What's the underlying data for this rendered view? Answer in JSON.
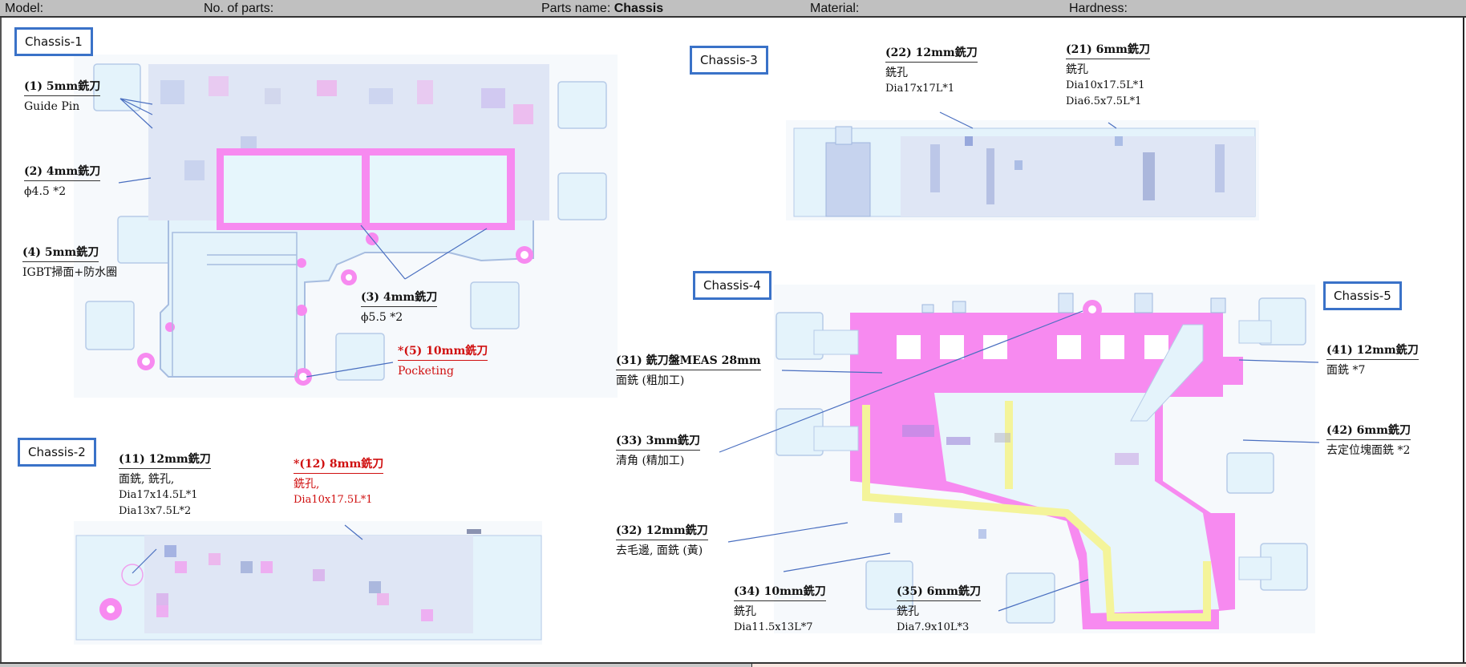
{
  "header": {
    "model_label": "Model:",
    "parts_count_label": "No. of parts:",
    "parts_name_label": "Parts name:",
    "parts_name_value": "Chassis",
    "material_label": "Material:",
    "hardness_label": "Hardness:"
  },
  "views": [
    {
      "id": "chassis-1",
      "label": "Chassis-1"
    },
    {
      "id": "chassis-2",
      "label": "Chassis-2"
    },
    {
      "id": "chassis-3",
      "label": "Chassis-3"
    },
    {
      "id": "chassis-4",
      "label": "Chassis-4"
    },
    {
      "id": "chassis-5",
      "label": "Chassis-5"
    }
  ],
  "annotations": {
    "a1": {
      "title": "(1) 5mm銑刀",
      "lines": [
        "Guide Pin"
      ]
    },
    "a2": {
      "title": "(2) 4mm銑刀",
      "lines": [
        "ϕ4.5 *2"
      ]
    },
    "a4": {
      "title": "(4) 5mm銑刀",
      "lines": [
        "IGBT掃面+防水圈"
      ]
    },
    "a3": {
      "title": "(3) 4mm銑刀",
      "lines": [
        "ϕ5.5 *2"
      ]
    },
    "a5": {
      "title": "*(5) 10mm銑刀",
      "lines": [
        "Pocketing"
      ],
      "highlight": true
    },
    "a11": {
      "title": "(11) 12mm銑刀",
      "lines": [
        "面銑, 銑孔,",
        "Dia17x14.5L*1",
        "Dia13x7.5L*2"
      ]
    },
    "a12": {
      "title": "*(12) 8mm銑刀",
      "lines": [
        "銑孔,",
        "Dia10x17.5L*1"
      ],
      "highlight": true
    },
    "a22": {
      "title": "(22) 12mm銑刀",
      "lines": [
        "銑孔",
        "Dia17x17L*1"
      ]
    },
    "a21": {
      "title": "(21) 6mm銑刀",
      "lines": [
        "銑孔",
        "Dia10x17.5L*1",
        "Dia6.5x7.5L*1"
      ]
    },
    "a31": {
      "title": "(31) 銑刀盤MEAS 28mm",
      "lines": [
        "面銑 (粗加工)"
      ]
    },
    "a33": {
      "title": "(33) 3mm銑刀",
      "lines": [
        "清角 (精加工)"
      ]
    },
    "a32": {
      "title": "(32) 12mm銑刀",
      "lines": [
        "去毛邊, 面銑 (黃)"
      ]
    },
    "a34": {
      "title": "(34) 10mm銑刀",
      "lines": [
        "銑孔",
        "Dia11.5x13L*7"
      ]
    },
    "a35": {
      "title": "(35) 6mm銑刀",
      "lines": [
        "銑孔",
        "Dia7.9x10L*3"
      ]
    },
    "a41": {
      "title": "(41) 12mm銑刀",
      "lines": [
        "面銑 *7"
      ]
    },
    "a42": {
      "title": "(42) 6mm銑刀",
      "lines": [
        "去定位塊面銑 *2"
      ]
    }
  },
  "colors": {
    "label_border": "#3a72c8",
    "highlight_text": "#d01010",
    "part_fill": "#e4f3fb",
    "part_stroke": "#9fb6de",
    "milled_face": "#f78af0",
    "yellow_path": "#f4f49a",
    "leader_line": "#4a6fc0"
  }
}
